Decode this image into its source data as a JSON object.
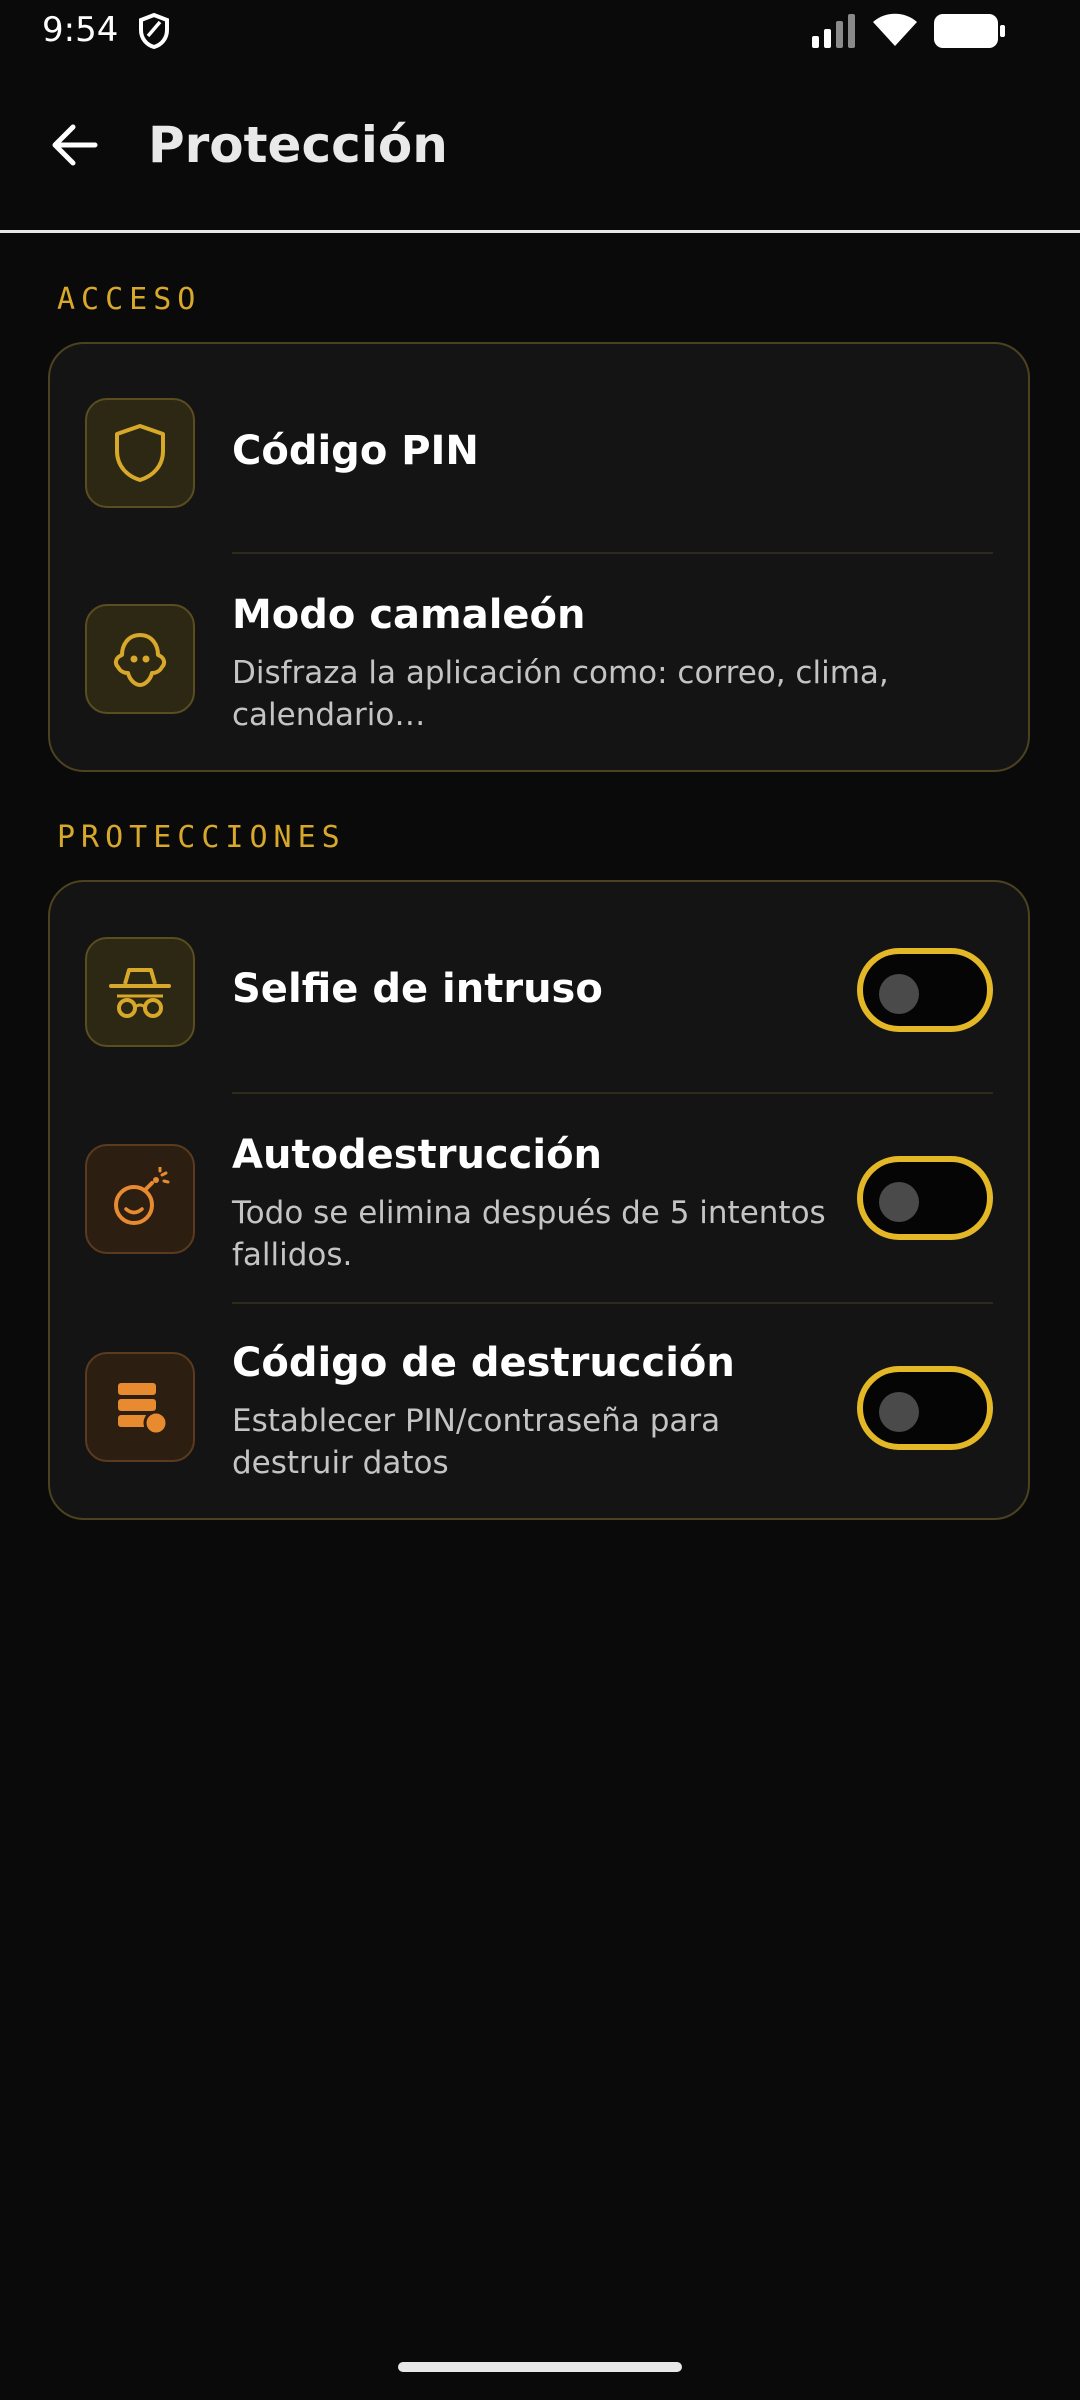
{
  "status_bar": {
    "time": "9:54",
    "icons": [
      "shield-icon",
      "signal-icon",
      "wifi-icon",
      "battery-icon"
    ]
  },
  "app_bar": {
    "back_icon": "arrow-left-icon",
    "title": "Protección"
  },
  "sections": {
    "access": {
      "label": "ACCESO",
      "items": [
        {
          "title": "Código PIN",
          "icon": "shield-icon"
        },
        {
          "title": "Modo camaleón",
          "description": "Disfraza la aplicación como: correo, clima, calendario…",
          "icon": "ghost-icon"
        }
      ]
    },
    "protections": {
      "label": "PROTECCIONES",
      "items": [
        {
          "title": "Selfie de intruso",
          "icon": "spy-icon",
          "enabled": false
        },
        {
          "title": "Autodestrucción",
          "description": "Todo se elimina después de 5 intentos fallidos.",
          "icon": "bomb-icon",
          "enabled": false
        },
        {
          "title": "Código de destrucción",
          "description": "Establecer PIN/contraseña para destruir datos",
          "icon": "data-destroy-icon",
          "enabled": false
        }
      ]
    }
  },
  "colors": {
    "background": "#0a0a0a",
    "card": "#141414",
    "accent_gold": "#d8a82a",
    "toggle_border": "#e3b726",
    "accent_orange": "#e88a30"
  }
}
